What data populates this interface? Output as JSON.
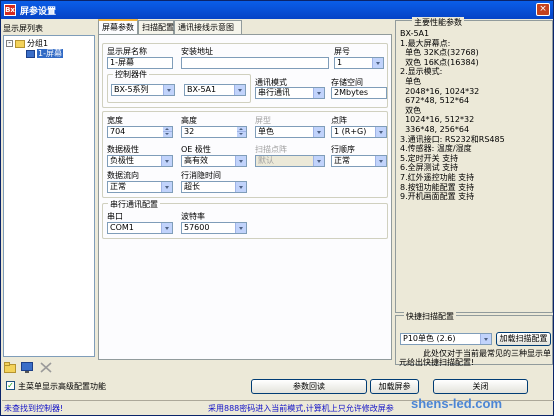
{
  "window": {
    "title": "屏参设置",
    "app_icon": "Bx",
    "close": "×"
  },
  "left": {
    "header": "显示屏列表",
    "group": "分组1",
    "screen": "1-屏幕",
    "expand": "-"
  },
  "tabs": [
    "屏幕参数",
    "扫描配置",
    "通讯接线示意图"
  ],
  "form": {
    "name_label": "显示屏名称",
    "name_value": "1-屏幕",
    "addr_label": "安装地址",
    "addr_value": "",
    "no_label": "屏号",
    "no_value": "1",
    "ctrl_label": "控制器件",
    "series_value": "BX-5系列",
    "model_value": "BX-5A1",
    "comm_label": "通讯模式",
    "comm_value": "串行通讯",
    "storage_label": "存储空间",
    "storage_value": "2Mbytes",
    "width_label": "宽度",
    "width_value": "704",
    "height_label": "高度",
    "height_value": "32",
    "color_label": "屏型",
    "color_value": "单色",
    "dot_label": "点阵",
    "dot_value": "1 (R+G)",
    "data_pol_label": "数据极性",
    "data_pol_value": "负极性",
    "oe_label": "OE 极性",
    "oe_value": "高有效",
    "scan_label": "扫描点阵",
    "scan_value": "默认",
    "row_order_label": "行顺序",
    "row_order_value": "正常",
    "data_dir_label": "数据流向",
    "data_dir_value": "正常",
    "blank_label": "行消隐时间",
    "blank_value": "超长",
    "serial_group": "串行通讯配置",
    "port_label": "串口",
    "port_value": "COM1",
    "baud_label": "波特率",
    "baud_value": "57600"
  },
  "right": {
    "title": "主要性能参数",
    "info": "BX-5A1\n1.最大屏幕点:\n  单色 32K点(32768)\n  双色 16K点(16384)\n2.显示模式:\n  单色\n  2048*16, 1024*32\n  672*48, 512*64\n  双色\n  1024*16, 512*32\n  336*48, 256*64\n3.通讯接口: RS232和RS485\n4.传感器: 温度/湿度\n5.定时开关 支持\n6.全屏测试 支持\n7.红外遥控功能 支持\n8.按钮功能配置 支持\n9.开机画面配置 支持"
  },
  "quick": {
    "title": "快捷扫描配置",
    "select_value": "P10单色 (2.6)",
    "load_button": "加载扫描配置",
    "note": "此处仅对于当前最常见的三种显示单元给出快捷扫描配置!"
  },
  "bottom": {
    "checkbox_label": "主菜单显示高级配置功能",
    "check_mark": "✓",
    "read_button": "参数回读",
    "load_button": "加载屏参",
    "close_button": "关闭"
  },
  "status": {
    "left": "未查找到控制器!",
    "right": "采用888密码进入当前模式,计算机上只允许修改屏参"
  },
  "watermark": "shens-led.com"
}
